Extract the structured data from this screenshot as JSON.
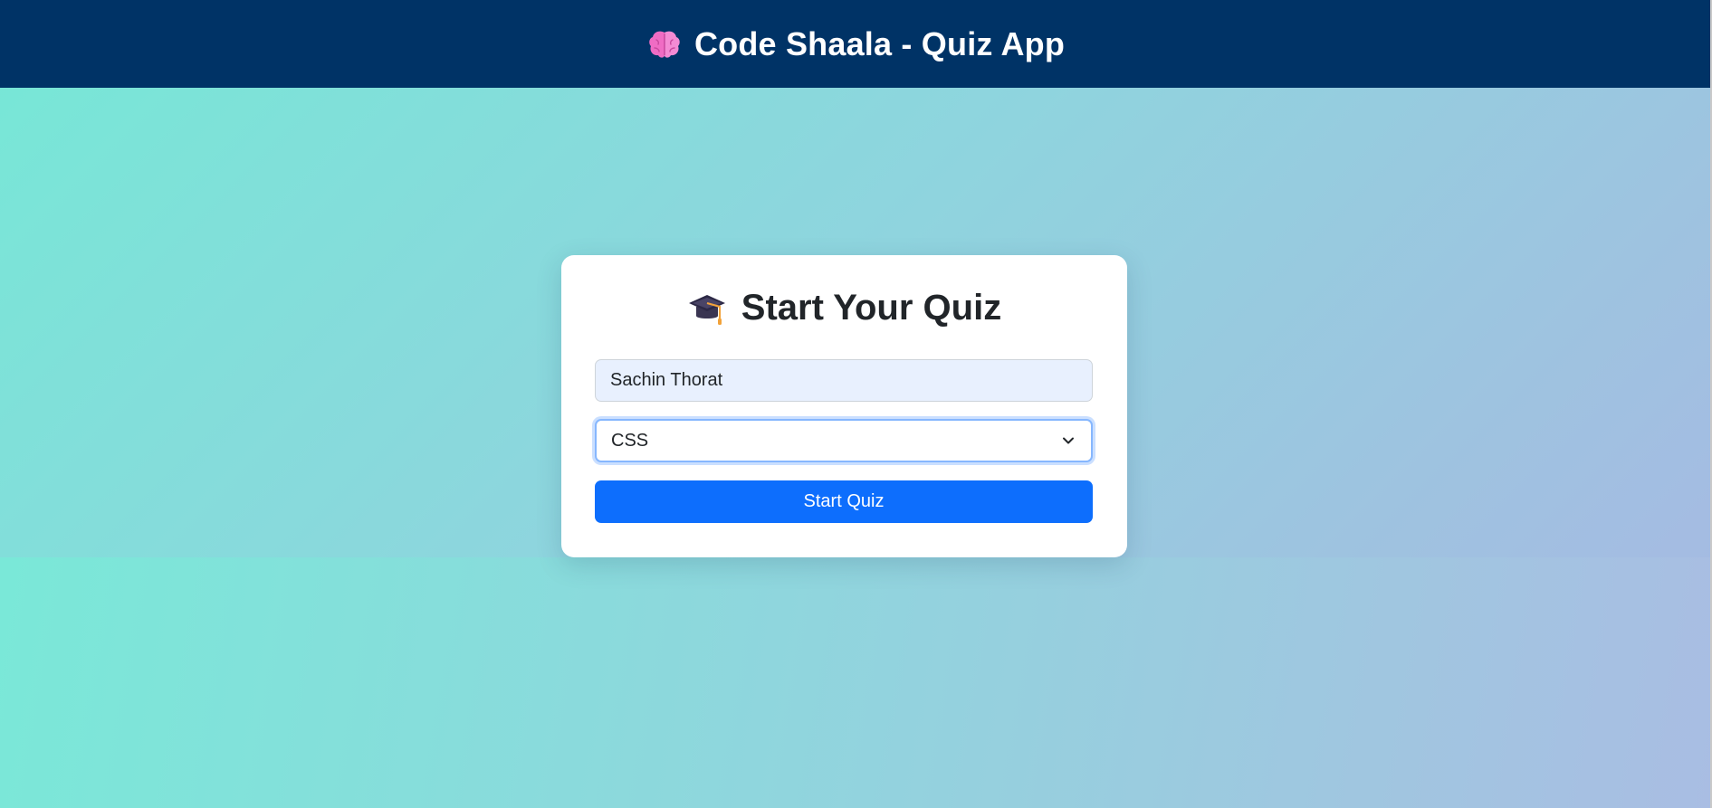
{
  "header": {
    "icon": "brain-icon",
    "title": "Code Shaala - Quiz App",
    "background": "#003366"
  },
  "card": {
    "icon": "graduation-cap-icon",
    "title": "Start Your Quiz"
  },
  "form": {
    "name_value": "Sachin Thorat",
    "topic_selected": "CSS",
    "start_label": "Start Quiz",
    "accent": "#0d6efd"
  }
}
